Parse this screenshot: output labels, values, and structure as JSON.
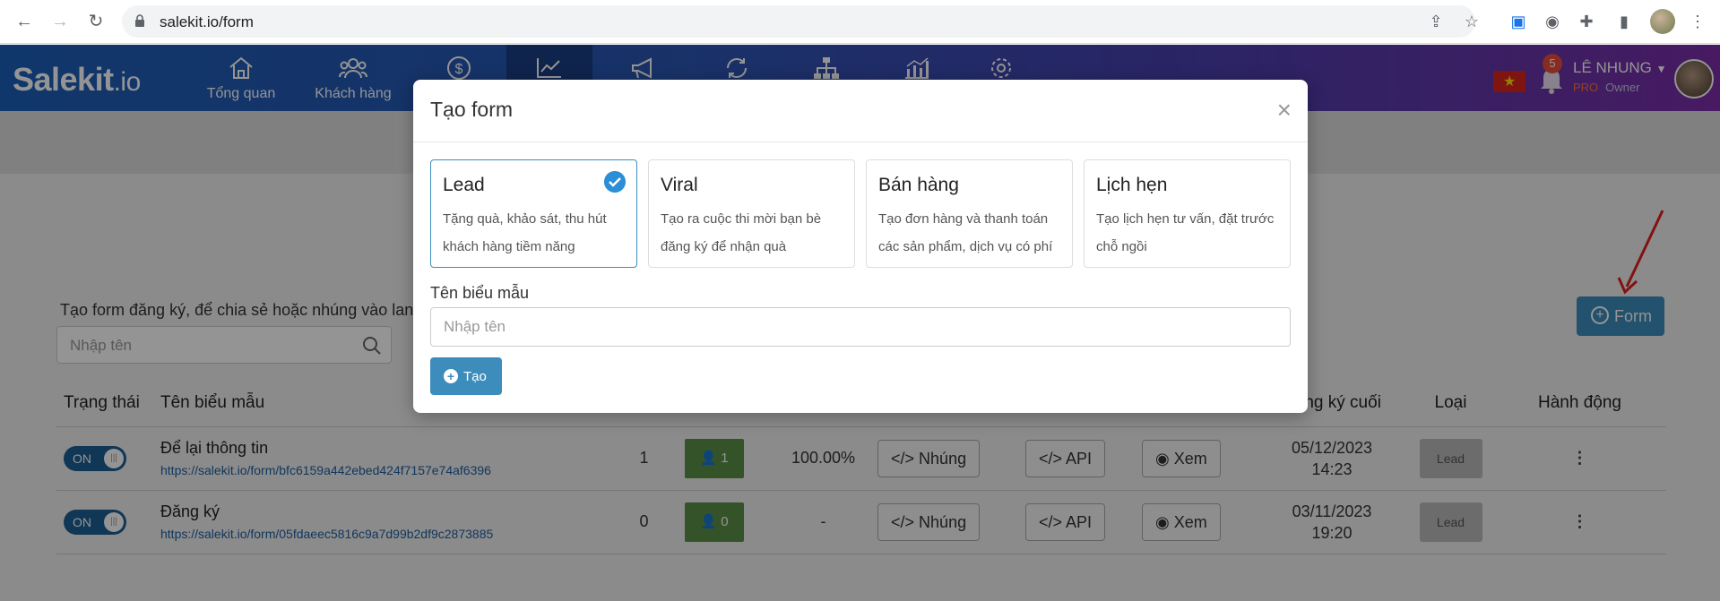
{
  "browser": {
    "url": "salekit.io/form"
  },
  "header": {
    "logo_main": "Salekit",
    "logo_suffix": ".io",
    "nav": [
      {
        "label": "Tổng quan",
        "icon": "home-icon"
      },
      {
        "label": "Khách hàng",
        "icon": "users-icon"
      },
      {
        "label": "",
        "icon": "dollar-icon"
      },
      {
        "label": "",
        "icon": "chart-icon"
      },
      {
        "label": "",
        "icon": "megaphone-icon"
      },
      {
        "label": "",
        "icon": "refresh-icon"
      },
      {
        "label": "",
        "icon": "sitemap-icon"
      },
      {
        "label": "",
        "icon": "bar-chart-icon"
      },
      {
        "label": "",
        "icon": "gear-icon"
      }
    ],
    "notification_count": "5",
    "user_name": "LÊ NHUNG",
    "user_plan": "PRO",
    "user_role": "Owner"
  },
  "page": {
    "description": "Tạo form đăng ký, để chia sẻ hoặc nhúng vào lan",
    "search_placeholder": "Nhập tên",
    "add_form_label": "Form",
    "table": {
      "headers": [
        "Trạng thái",
        "Tên biểu mẫu",
        "",
        "",
        "",
        "",
        "",
        "",
        "Đăng ký cuối",
        "Loại",
        "Hành động"
      ],
      "rows": [
        {
          "status": "ON",
          "name": "Để lại thông tin",
          "link": "https://salekit.io/form/bfc6159a442ebed424f7157e74af6396",
          "count": "1",
          "users": "1",
          "rate": "100.00%",
          "embed": "Nhúng",
          "api": "API",
          "view": "Xem",
          "last_date": "05/12/2023",
          "last_time": "14:23",
          "type": "Lead"
        },
        {
          "status": "ON",
          "name": "Đăng ký",
          "link": "https://salekit.io/form/05fdaeec5816c9a7d99b2df9c2873885",
          "count": "0",
          "users": "0",
          "rate": "-",
          "embed": "Nhúng",
          "api": "API",
          "view": "Xem",
          "last_date": "03/11/2023",
          "last_time": "19:20",
          "type": "Lead"
        }
      ]
    }
  },
  "modal": {
    "title": "Tạo form",
    "close": "×",
    "types": [
      {
        "title": "Lead",
        "desc": "Tặng quà, khảo sát, thu hút khách hàng tiềm năng",
        "selected": true
      },
      {
        "title": "Viral",
        "desc": "Tạo ra cuộc thi mời bạn bè đăng ký để nhận quà",
        "selected": false
      },
      {
        "title": "Bán hàng",
        "desc": "Tạo đơn hàng và thanh toán các sản phẩm, dịch vụ có phí",
        "selected": false
      },
      {
        "title": "Lịch hẹn",
        "desc": "Tạo lịch hẹn tư vấn, đặt trước chỗ ngồi",
        "selected": false
      }
    ],
    "name_label": "Tên biểu mẫu",
    "name_placeholder": "Nhập tên",
    "name_value": "",
    "create_label": "Tạo"
  },
  "colors": {
    "primary": "#3c8dbc",
    "toggle": "#1d5f94",
    "success": "#5b8f45",
    "header_start": "#1d5fb8",
    "header_end": "#7b2ea8",
    "annotation_arrow": "#e02020"
  }
}
